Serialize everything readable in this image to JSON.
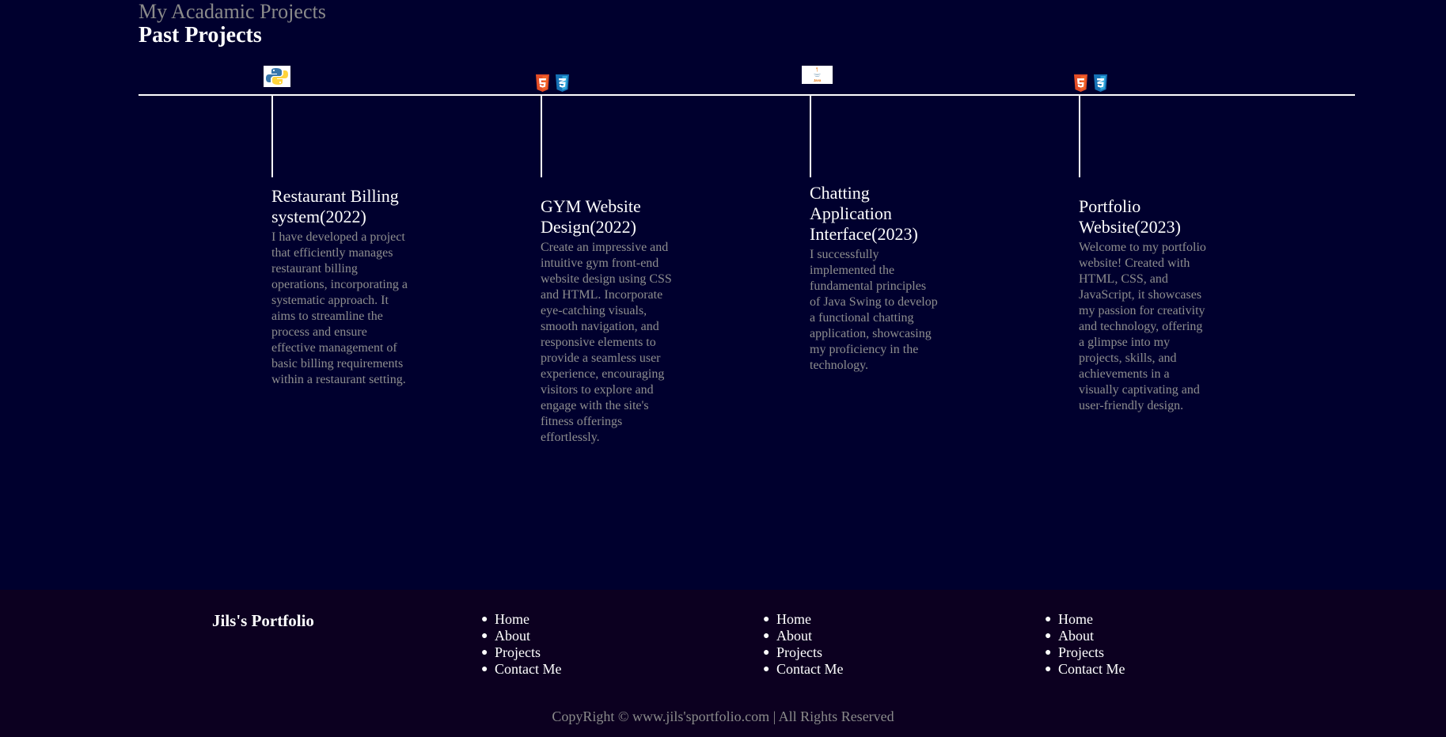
{
  "header": {
    "subtitle": "My Acadamic Projects",
    "title": "Past Projects"
  },
  "projects": [
    {
      "tech_icons": [
        "python-logo-icon"
      ],
      "title": "Restaurant Billing system(2022)",
      "description": "I have developed a project that efficiently manages restaurant billing operations, incorporating a systematic approach. It aims to streamline the process and ensure effective management of basic billing requirements within a restaurant setting."
    },
    {
      "tech_icons": [
        "html5-logo-icon",
        "css3-logo-icon"
      ],
      "title": "GYM Website Design(2022)",
      "description": "Create an impressive and intuitive gym front-end website design using CSS and HTML. Incorporate eye-catching visuals, smooth navigation, and responsive elements to provide a seamless user experience, encouraging visitors to explore and engage with the site's fitness offerings effortlessly."
    },
    {
      "tech_icons": [
        "java-logo-icon"
      ],
      "title": "Chatting Application Interface(2023)",
      "description": "I successfully implemented the fundamental principles of Java Swing to develop a functional chatting application, showcasing my proficiency in the technology."
    },
    {
      "tech_icons": [
        "html5-logo-icon",
        "css3-logo-icon"
      ],
      "title": "Portfolio Website(2023)",
      "description": "Welcome to my portfolio website! Created with HTML, CSS, and JavaScript, it showcases my passion for creativity and technology, offering a glimpse into my projects, skills, and achievements in a visually captivating and user-friendly design."
    }
  ],
  "footer": {
    "brand": "Jils's Portfolio",
    "link_columns": [
      [
        "Home",
        "About",
        "Projects",
        "Contact Me"
      ],
      [
        "Home",
        "About",
        "Projects",
        "Contact Me"
      ],
      [
        "Home",
        "About",
        "Projects",
        "Contact Me"
      ]
    ],
    "copyright": "CopyRight © www.jils'sportfolio.com | All Rights Reserved"
  },
  "colors": {
    "background": "#00002e",
    "footer_background": "#0c0020",
    "text_primary": "#ffffff",
    "text_muted": "#8e8e8e",
    "html5_orange": "#e44d26",
    "css3_blue": "#1572b6",
    "python_blue": "#3776ab",
    "python_yellow": "#ffd43b",
    "java_red": "#e76f00"
  }
}
